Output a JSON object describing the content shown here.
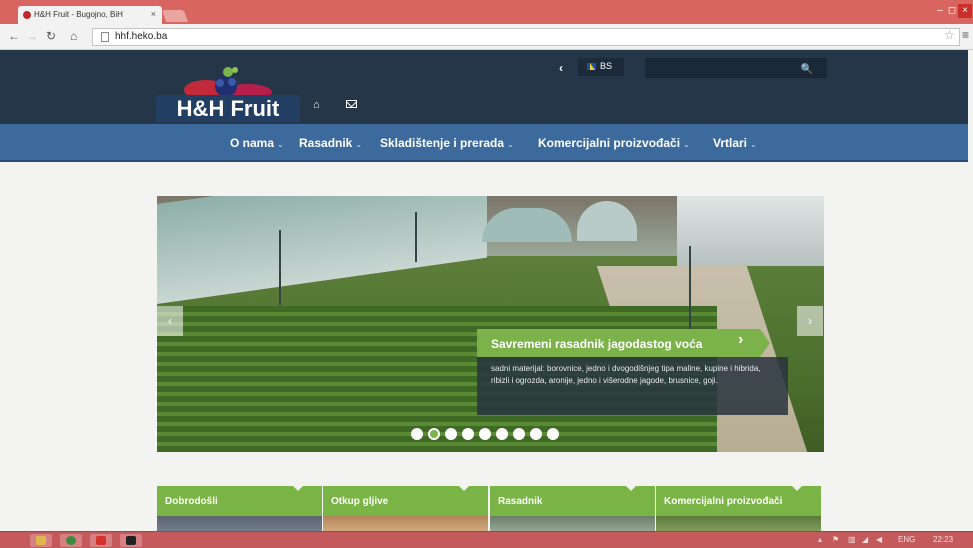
{
  "browser": {
    "tab_title": "H&H Fruit - Bugojno, BiH",
    "tab_close": "×",
    "url": "hhf.heko.ba",
    "win_min": "–",
    "win_max": "◻",
    "win_close": "×"
  },
  "header": {
    "logo_text": "H&H Fruit",
    "lang_prev": "‹",
    "lang_label": "BS",
    "search_placeholder": "",
    "search_icon": "🔍"
  },
  "nav": {
    "items": [
      {
        "label": "O nama"
      },
      {
        "label": "Rasadnik"
      },
      {
        "label": "Skladištenje i prerada"
      },
      {
        "label": "Komercijalni proizvođači"
      },
      {
        "label": "Vrtlari"
      }
    ],
    "chevron": "⌄"
  },
  "slider": {
    "caption_title": "Savremeni rasadnik jagodastog voća",
    "caption_text": "sadni materijal: borovnice, jedno i dvogodišnjeg tipa maline, kupine i hibrida, ribizli i ogrozda, aronije, jedno i višerodne jagode, brusnice, goji.",
    "prev": "‹",
    "next": "›",
    "slide_count": 9,
    "active_slide": 1
  },
  "tiles": [
    {
      "label": "Dobrodošli"
    },
    {
      "label": "Otkup gljive"
    },
    {
      "label": "Rasadnik"
    },
    {
      "label": "Komercijalni proizvođači"
    }
  ],
  "taskbar": {
    "lang": "ENG",
    "time": "22:23"
  },
  "colors": {
    "header_bg": "#253649",
    "nav_bg": "#3d6a9d",
    "accent_green": "#7cb24a",
    "chrome_red": "#d8655f"
  }
}
